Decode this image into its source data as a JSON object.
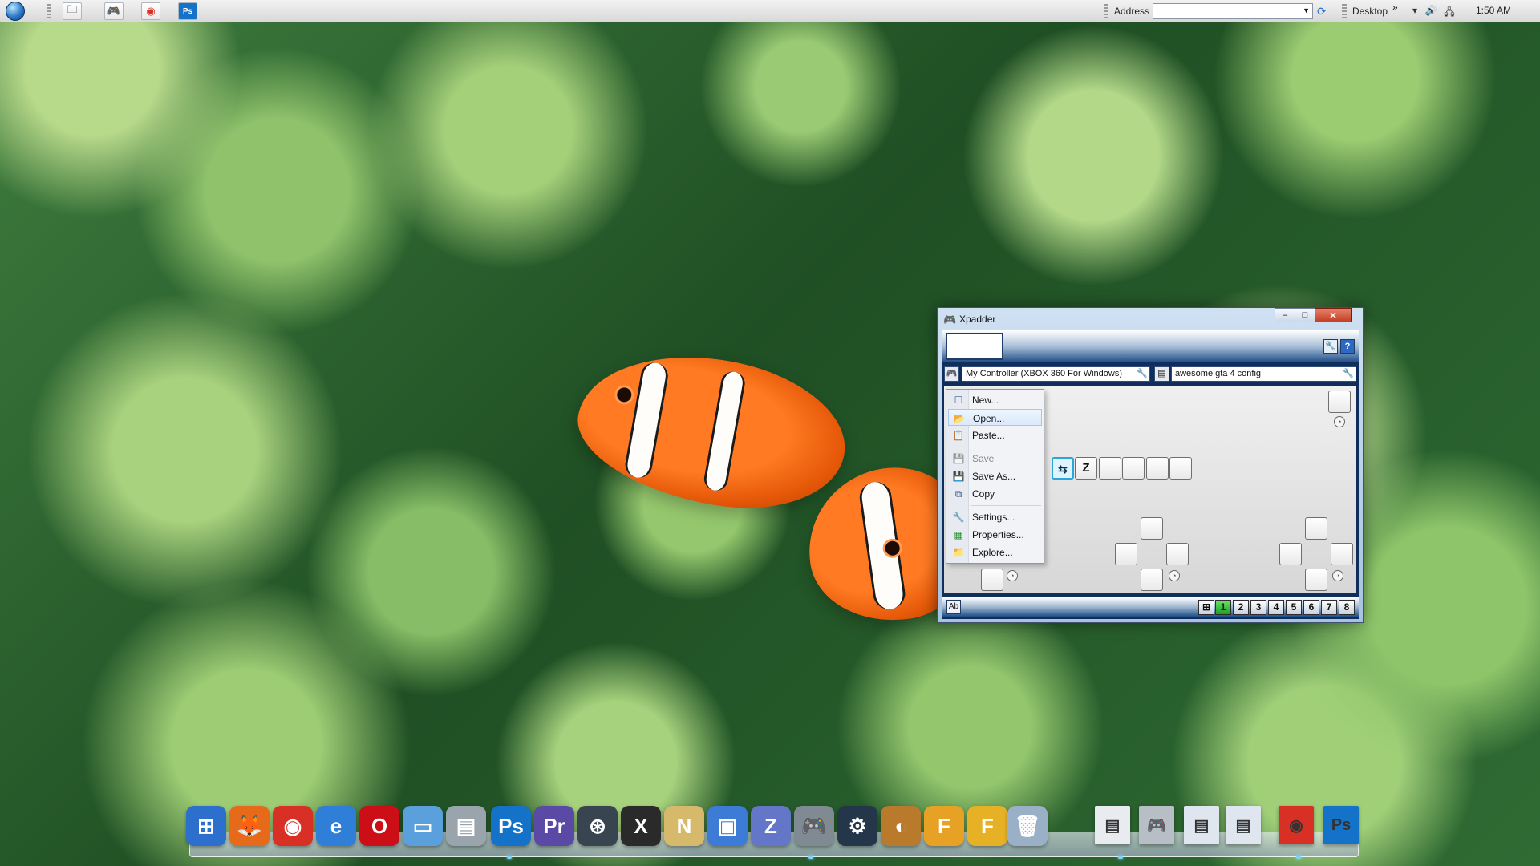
{
  "taskbar": {
    "quick_launch": [
      {
        "name": "folder-icon",
        "glyph": "🗀"
      },
      {
        "name": "gamepad-icon",
        "glyph": "🎮"
      },
      {
        "name": "chrome-icon",
        "glyph": "◉"
      },
      {
        "name": "photoshop-icon",
        "glyph": "Ps"
      }
    ],
    "address_label": "Address",
    "address_value": "",
    "desktop_label": "Desktop",
    "time": "1:50 AM"
  },
  "xpadder": {
    "title": "Xpadder",
    "controller_combo": "My Controller (XBOX 360 For Windows)",
    "profile_combo": "awesome gta 4 config",
    "keys": {
      "z_key": "Z",
      "highlighted": "⇆"
    },
    "sets": [
      {
        "label": "1",
        "active": true
      },
      {
        "label": "2",
        "active": false
      },
      {
        "label": "3",
        "active": false
      },
      {
        "label": "4",
        "active": false
      },
      {
        "label": "5",
        "active": false
      },
      {
        "label": "6",
        "active": false
      },
      {
        "label": "7",
        "active": false
      },
      {
        "label": "8",
        "active": false
      }
    ],
    "menu": {
      "items": [
        {
          "label": "New...",
          "icon": "new-icon",
          "glyph": "☐",
          "disabled": false,
          "hover": false
        },
        {
          "label": "Open...",
          "icon": "open-folder-icon",
          "glyph": "📂",
          "disabled": false,
          "hover": true
        },
        {
          "label": "Paste...",
          "icon": "paste-icon",
          "glyph": "📋",
          "disabled": false,
          "hover": false
        },
        {
          "label": "Save",
          "icon": "save-icon",
          "glyph": "💾",
          "disabled": true,
          "hover": false
        },
        {
          "label": "Save As...",
          "icon": "save-as-icon",
          "glyph": "💾",
          "disabled": false,
          "hover": false
        },
        {
          "label": "Copy",
          "icon": "copy-icon",
          "glyph": "⧉",
          "disabled": false,
          "hover": false
        },
        {
          "label": "Settings...",
          "icon": "wrench-icon",
          "glyph": "🔧",
          "disabled": false,
          "hover": false
        },
        {
          "label": "Properties...",
          "icon": "properties-icon",
          "glyph": "▦",
          "disabled": false,
          "hover": false
        },
        {
          "label": "Explore...",
          "icon": "explore-folder-icon",
          "glyph": "📁",
          "disabled": false,
          "hover": false
        }
      ]
    }
  },
  "dock": {
    "icons": [
      {
        "name": "windows-start-dock-icon",
        "label": "⊞",
        "color": "#2d6fcc"
      },
      {
        "name": "firefox-icon",
        "label": "🦊",
        "color": "#e66a1a"
      },
      {
        "name": "chrome-dock-icon",
        "label": "◉",
        "color": "#d93025"
      },
      {
        "name": "internet-explorer-icon",
        "label": "e",
        "color": "#2f7ed8"
      },
      {
        "name": "opera-icon",
        "label": "O",
        "color": "#cc0f16"
      },
      {
        "name": "folder-dock-icon",
        "label": "▭",
        "color": "#5aa0dc"
      },
      {
        "name": "drive-icon",
        "label": "▤",
        "color": "#9aa4ad"
      },
      {
        "name": "photoshop-dock-icon",
        "label": "Ps",
        "color": "#1473c9"
      },
      {
        "name": "premiere-icon",
        "label": "Pr",
        "color": "#5b4aa5"
      },
      {
        "name": "game-controller-dock-icon",
        "label": "⊛",
        "color": "#394451"
      },
      {
        "name": "xsplit-icon",
        "label": "X",
        "color": "#2a2a2a"
      },
      {
        "name": "notepad-icon",
        "label": "N",
        "color": "#d6b96a"
      },
      {
        "name": "monitor-icon",
        "label": "▣",
        "color": "#3c7bd6"
      },
      {
        "name": "zune-icon",
        "label": "Z",
        "color": "#6376c8"
      },
      {
        "name": "gamepad-dock-icon",
        "label": "🎮",
        "color": "#808a93"
      },
      {
        "name": "steam-icon",
        "label": "⚙",
        "color": "#23364a"
      },
      {
        "name": "media-icon",
        "label": "◐",
        "color": "#b97a2b"
      },
      {
        "name": "fl-studio-icon",
        "label": "F",
        "color": "#e7a125"
      },
      {
        "name": "fl-studio-alt-icon",
        "label": "F",
        "color": "#e7b125"
      },
      {
        "name": "recycle-bin-icon",
        "label": "🗑",
        "color": "#9ab0c6"
      },
      {
        "name": "window-thumb-icon",
        "label": "▤",
        "color": "#e8ebf0"
      },
      {
        "name": "gamepad-thumb-icon",
        "label": "🎮",
        "color": "#b8bec6"
      },
      {
        "name": "folder-thumb-icon",
        "label": "▤",
        "color": "#dfe6f0"
      },
      {
        "name": "folder-thumb-icon-2",
        "label": "▤",
        "color": "#dfe6f0"
      },
      {
        "name": "chrome-thumb-icon",
        "label": "◉",
        "color": "#d93025"
      },
      {
        "name": "photoshop-thumb-icon",
        "label": "Ps",
        "color": "#1473c9"
      }
    ]
  }
}
